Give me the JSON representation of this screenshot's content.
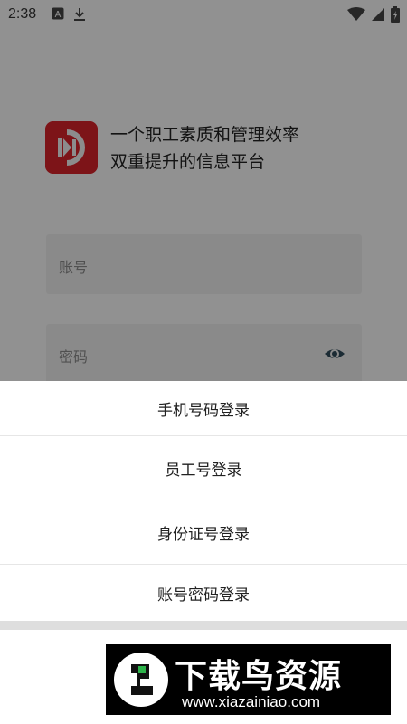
{
  "status_bar": {
    "time": "2:38",
    "left_icons": [
      "a-notification-icon",
      "download-icon"
    ],
    "right_icons": [
      "wifi-icon",
      "signal-icon",
      "battery-icon"
    ]
  },
  "login": {
    "slogan_line1": "一个职工素质和管理效率",
    "slogan_line2": "双重提升的信息平台",
    "account_placeholder": "账号",
    "password_placeholder": "密码",
    "logo_color": "#d8242a"
  },
  "sheet": {
    "options": [
      {
        "label": "手机号码登录"
      },
      {
        "label": "员工号登录"
      },
      {
        "label": "身份证号登录"
      },
      {
        "label": "账号密码登录"
      }
    ]
  },
  "watermark": {
    "title": "下载鸟资源",
    "url": "www.xiazainiao.com"
  }
}
